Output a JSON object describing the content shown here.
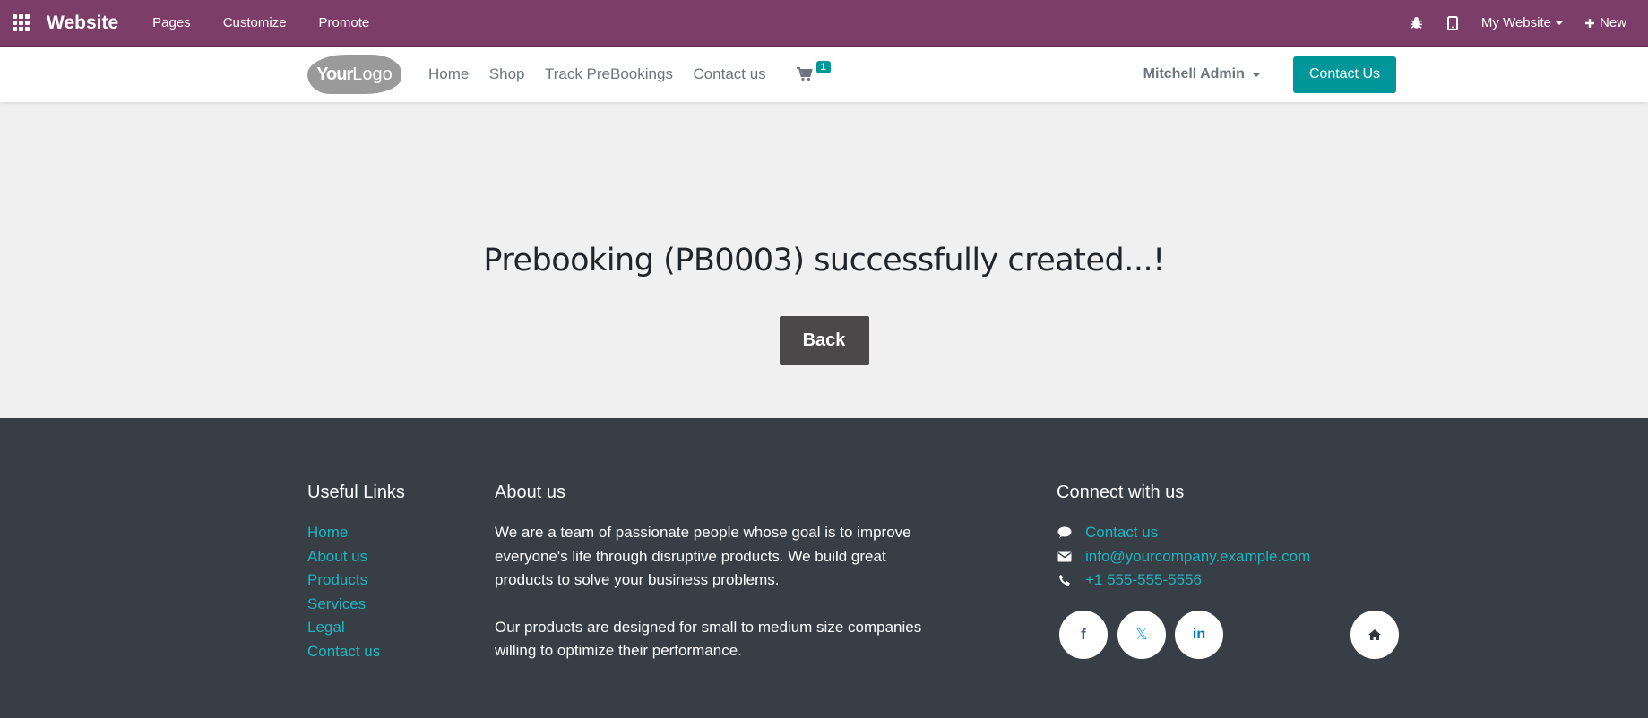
{
  "admin_bar": {
    "brand": "Website",
    "menu": [
      "Pages",
      "Customize",
      "Promote"
    ],
    "my_website": "My Website",
    "new_label": "New"
  },
  "header": {
    "nav": [
      "Home",
      "Shop",
      "Track PreBookings",
      "Contact us"
    ],
    "cart_count": "1",
    "user": "Mitchell Admin",
    "cta": "Contact Us"
  },
  "main": {
    "message": "Prebooking (PB0003) successfully created...!",
    "back_label": "Back"
  },
  "footer": {
    "useful_links_title": "Useful Links",
    "useful_links": [
      "Home",
      "About us",
      "Products",
      "Services",
      "Legal",
      "Contact us"
    ],
    "about_title": "About us",
    "about_p1": "We are a team of passionate people whose goal is to improve everyone's life through disruptive products. We build great products to solve your business problems.",
    "about_p2": "Our products are designed for small to medium size companies willing to optimize their performance.",
    "connect_title": "Connect with us",
    "contact_link": "Contact us",
    "email": "info@yourcompany.example.com",
    "phone": "+1 555-555-5556",
    "socials": [
      "f",
      "𝕏",
      "in"
    ]
  },
  "colors": {
    "admin_bar": "#7c3e68",
    "accent": "#00969a",
    "footer_bg": "#383e45",
    "footer_link": "#1fb5c0"
  }
}
